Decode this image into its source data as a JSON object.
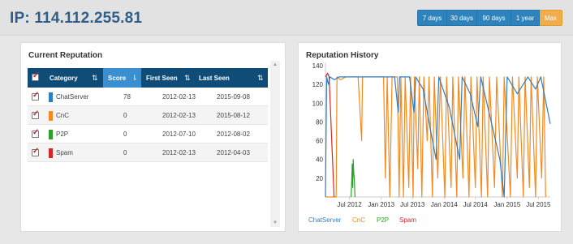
{
  "header": {
    "title": "IP: 114.112.255.81",
    "range_buttons": [
      {
        "label": "7 days",
        "active": false
      },
      {
        "label": "30 days",
        "active": false
      },
      {
        "label": "90 days",
        "active": false
      },
      {
        "label": "1 year",
        "active": false
      },
      {
        "label": "Max",
        "active": true
      }
    ]
  },
  "reputation": {
    "title": "Current Reputation",
    "columns": [
      "Category",
      "Score",
      "First Seen",
      "Last Seen"
    ],
    "sorted_column": "Score",
    "rows": [
      {
        "category": "ChatServer",
        "color": "#2d7fc1",
        "score": "78",
        "first_seen": "2012-02-13",
        "last_seen": "2015-09-08",
        "checked": true
      },
      {
        "category": "CnC",
        "color": "#f5891f",
        "score": "0",
        "first_seen": "2012-02-13",
        "last_seen": "2015-08-12",
        "checked": true
      },
      {
        "category": "P2P",
        "color": "#2ca02c",
        "score": "0",
        "first_seen": "2012-07-10",
        "last_seen": "2012-08-02",
        "checked": true
      },
      {
        "category": "Spam",
        "color": "#d62728",
        "score": "0",
        "first_seen": "2012-02-13",
        "last_seen": "2012-04-03",
        "checked": true
      }
    ]
  },
  "history": {
    "title": "Reputation History",
    "legend": [
      {
        "name": "ChatServer",
        "color": "#2d7fc1"
      },
      {
        "name": "CnC",
        "color": "#f5891f"
      },
      {
        "name": "P2P",
        "color": "#2ca02c"
      },
      {
        "name": "Spam",
        "color": "#d62728"
      }
    ]
  },
  "chart_data": {
    "type": "line",
    "title": "Reputation History",
    "xlabel": "",
    "ylabel": "",
    "ylim": [
      0,
      140
    ],
    "yticks": [
      20,
      40,
      60,
      80,
      100,
      120,
      140
    ],
    "xticks": [
      "Jul 2012",
      "Jan 2013",
      "Jul 2013",
      "Jan 2014",
      "Jul 2014",
      "Jan 2015",
      "Jul 2015"
    ],
    "xlim": [
      "2012-02-13",
      "2015-09-08"
    ],
    "grid": false,
    "legend_position": "bottom",
    "series": [
      {
        "name": "ChatServer",
        "color": "#2d7fc1",
        "points": [
          [
            "2012-02-13",
            0
          ],
          [
            "2012-02-20",
            128
          ],
          [
            "2012-03-01",
            120
          ],
          [
            "2012-03-10",
            128
          ],
          [
            "2012-04-05",
            125
          ],
          [
            "2012-05-01",
            128
          ],
          [
            "2012-06-01",
            128
          ],
          [
            "2012-09-01",
            128
          ],
          [
            "2012-12-01",
            128
          ],
          [
            "2013-03-01",
            128
          ],
          [
            "2013-03-20",
            128
          ],
          [
            "2013-04-10",
            90
          ],
          [
            "2013-04-18",
            128
          ],
          [
            "2013-06-15",
            128
          ],
          [
            "2013-07-10",
            90
          ],
          [
            "2013-07-20",
            128
          ],
          [
            "2013-09-01",
            115
          ],
          [
            "2013-10-15",
            70
          ],
          [
            "2013-11-15",
            40
          ],
          [
            "2013-12-01",
            128
          ],
          [
            "2014-02-01",
            95
          ],
          [
            "2014-04-01",
            40
          ],
          [
            "2014-04-15",
            128
          ],
          [
            "2014-06-01",
            110
          ],
          [
            "2014-07-15",
            75
          ],
          [
            "2014-08-01",
            128
          ],
          [
            "2014-10-01",
            80
          ],
          [
            "2014-11-20",
            40
          ],
          [
            "2014-12-15",
            0
          ],
          [
            "2015-01-01",
            128
          ],
          [
            "2015-03-01",
            110
          ],
          [
            "2015-05-01",
            128
          ],
          [
            "2015-06-15",
            115
          ],
          [
            "2015-07-15",
            128
          ],
          [
            "2015-09-08",
            78
          ]
        ]
      },
      {
        "name": "CnC",
        "color": "#f5891f",
        "points": [
          [
            "2012-02-13",
            0
          ],
          [
            "2012-04-15",
            0
          ],
          [
            "2012-04-20",
            128
          ],
          [
            "2012-05-10",
            125
          ],
          [
            "2012-06-10",
            128
          ],
          [
            "2012-08-20",
            128
          ],
          [
            "2012-09-10",
            60
          ],
          [
            "2012-09-15",
            128
          ],
          [
            "2012-12-20",
            128
          ],
          [
            "2013-01-15",
            128
          ],
          [
            "2013-01-25",
            20
          ],
          [
            "2013-02-05",
            128
          ],
          [
            "2013-02-20",
            0
          ],
          [
            "2013-03-05",
            128
          ],
          [
            "2013-04-05",
            128
          ],
          [
            "2013-04-15",
            0
          ],
          [
            "2013-04-25",
            128
          ],
          [
            "2013-05-10",
            0
          ],
          [
            "2013-05-20",
            128
          ],
          [
            "2013-06-10",
            10
          ],
          [
            "2013-06-20",
            128
          ],
          [
            "2013-07-05",
            0
          ],
          [
            "2013-07-12",
            128
          ],
          [
            "2013-08-01",
            30
          ],
          [
            "2013-08-10",
            128
          ],
          [
            "2013-08-25",
            0
          ],
          [
            "2013-09-05",
            128
          ],
          [
            "2013-09-25",
            60
          ],
          [
            "2013-10-05",
            128
          ],
          [
            "2013-10-25",
            0
          ],
          [
            "2013-11-05",
            128
          ],
          [
            "2013-11-25",
            20
          ],
          [
            "2013-12-10",
            128
          ],
          [
            "2014-01-05",
            0
          ],
          [
            "2014-01-15",
            128
          ],
          [
            "2014-02-10",
            10
          ],
          [
            "2014-02-20",
            128
          ],
          [
            "2014-03-15",
            0
          ],
          [
            "2014-03-25",
            128
          ],
          [
            "2014-04-20",
            20
          ],
          [
            "2014-05-01",
            128
          ],
          [
            "2014-05-25",
            0
          ],
          [
            "2014-06-05",
            128
          ],
          [
            "2014-07-01",
            10
          ],
          [
            "2014-07-10",
            128
          ],
          [
            "2014-08-05",
            0
          ],
          [
            "2014-08-15",
            128
          ],
          [
            "2014-09-10",
            0
          ],
          [
            "2014-09-20",
            128
          ],
          [
            "2014-10-20",
            10
          ],
          [
            "2014-11-01",
            128
          ],
          [
            "2014-12-05",
            0
          ],
          [
            "2014-12-15",
            128
          ],
          [
            "2015-01-20",
            0
          ],
          [
            "2015-02-01",
            128
          ],
          [
            "2015-03-01",
            20
          ],
          [
            "2015-03-10",
            128
          ],
          [
            "2015-04-05",
            0
          ],
          [
            "2015-04-15",
            128
          ],
          [
            "2015-05-10",
            10
          ],
          [
            "2015-05-20",
            128
          ],
          [
            "2015-06-15",
            0
          ],
          [
            "2015-06-25",
            128
          ],
          [
            "2015-07-20",
            20
          ],
          [
            "2015-08-01",
            128
          ],
          [
            "2015-08-12",
            0
          ]
        ]
      },
      {
        "name": "P2P",
        "color": "#2ca02c",
        "points": [
          [
            "2012-07-10",
            0
          ],
          [
            "2012-07-14",
            15
          ],
          [
            "2012-07-17",
            35
          ],
          [
            "2012-07-20",
            10
          ],
          [
            "2012-07-23",
            40
          ],
          [
            "2012-07-26",
            25
          ],
          [
            "2012-07-29",
            20
          ],
          [
            "2012-08-02",
            0
          ]
        ]
      },
      {
        "name": "Spam",
        "color": "#d62728",
        "points": [
          [
            "2012-02-13",
            128
          ],
          [
            "2012-02-25",
            132
          ],
          [
            "2012-03-05",
            128
          ],
          [
            "2012-04-03",
            0
          ]
        ]
      }
    ]
  }
}
